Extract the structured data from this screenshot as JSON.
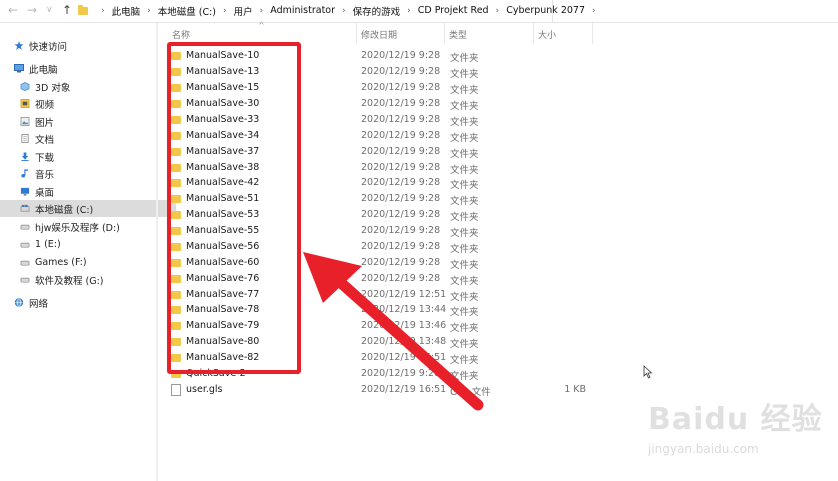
{
  "nav": {
    "back": "←",
    "forward": "→",
    "recent": "∨",
    "up": "↑"
  },
  "breadcrumb": [
    "此电脑",
    "本地磁盘 (C:)",
    "用户",
    "Administrator",
    "保存的游戏",
    "CD Projekt Red",
    "Cyberpunk 2077"
  ],
  "sidebar": {
    "items": [
      {
        "label": "快速访问",
        "icon": "star-icon"
      },
      {
        "label": "此电脑",
        "icon": "computer-icon"
      },
      {
        "label": "3D 对象",
        "icon": "cube-icon"
      },
      {
        "label": "视频",
        "icon": "video-icon"
      },
      {
        "label": "图片",
        "icon": "picture-icon"
      },
      {
        "label": "文档",
        "icon": "document-icon"
      },
      {
        "label": "下载",
        "icon": "download-icon"
      },
      {
        "label": "音乐",
        "icon": "music-icon"
      },
      {
        "label": "桌面",
        "icon": "desktop-icon"
      },
      {
        "label": "本地磁盘 (C:)",
        "icon": "drive-icon",
        "selected": true
      },
      {
        "label": "hjw娱乐及程序 (D:)",
        "icon": "drive-icon"
      },
      {
        "label": "1 (E:)",
        "icon": "drive-icon"
      },
      {
        "label": "Games (F:)",
        "icon": "drive-icon"
      },
      {
        "label": "软件及教程 (G:)",
        "icon": "drive-icon"
      },
      {
        "label": "网络",
        "icon": "network-icon"
      }
    ]
  },
  "columns": {
    "name": "名称",
    "date": "修改日期",
    "type": "类型",
    "size": "大小"
  },
  "files": [
    {
      "name": "ManualSave-10",
      "date": "2020/12/19 9:28",
      "type": "文件夹",
      "size": "",
      "kind": "folder"
    },
    {
      "name": "ManualSave-13",
      "date": "2020/12/19 9:28",
      "type": "文件夹",
      "size": "",
      "kind": "folder"
    },
    {
      "name": "ManualSave-15",
      "date": "2020/12/19 9:28",
      "type": "文件夹",
      "size": "",
      "kind": "folder"
    },
    {
      "name": "ManualSave-30",
      "date": "2020/12/19 9:28",
      "type": "文件夹",
      "size": "",
      "kind": "folder"
    },
    {
      "name": "ManualSave-33",
      "date": "2020/12/19 9:28",
      "type": "文件夹",
      "size": "",
      "kind": "folder"
    },
    {
      "name": "ManualSave-34",
      "date": "2020/12/19 9:28",
      "type": "文件夹",
      "size": "",
      "kind": "folder"
    },
    {
      "name": "ManualSave-37",
      "date": "2020/12/19 9:28",
      "type": "文件夹",
      "size": "",
      "kind": "folder"
    },
    {
      "name": "ManualSave-38",
      "date": "2020/12/19 9:28",
      "type": "文件夹",
      "size": "",
      "kind": "folder"
    },
    {
      "name": "ManualSave-42",
      "date": "2020/12/19 9:28",
      "type": "文件夹",
      "size": "",
      "kind": "folder"
    },
    {
      "name": "ManualSave-51",
      "date": "2020/12/19 9:28",
      "type": "文件夹",
      "size": "",
      "kind": "folder"
    },
    {
      "name": "ManualSave-53",
      "date": "2020/12/19 9:28",
      "type": "文件夹",
      "size": "",
      "kind": "folder"
    },
    {
      "name": "ManualSave-55",
      "date": "2020/12/19 9:28",
      "type": "文件夹",
      "size": "",
      "kind": "folder"
    },
    {
      "name": "ManualSave-56",
      "date": "2020/12/19 9:28",
      "type": "文件夹",
      "size": "",
      "kind": "folder"
    },
    {
      "name": "ManualSave-60",
      "date": "2020/12/19 9:28",
      "type": "文件夹",
      "size": "",
      "kind": "folder"
    },
    {
      "name": "ManualSave-76",
      "date": "2020/12/19 9:28",
      "type": "文件夹",
      "size": "",
      "kind": "folder"
    },
    {
      "name": "ManualSave-77",
      "date": "2020/12/19 12:51",
      "type": "文件夹",
      "size": "",
      "kind": "folder"
    },
    {
      "name": "ManualSave-78",
      "date": "2020/12/19 13:44",
      "type": "文件夹",
      "size": "",
      "kind": "folder"
    },
    {
      "name": "ManualSave-79",
      "date": "2020/12/19 13:46",
      "type": "文件夹",
      "size": "",
      "kind": "folder"
    },
    {
      "name": "ManualSave-80",
      "date": "2020/12/19 13:48",
      "type": "文件夹",
      "size": "",
      "kind": "folder"
    },
    {
      "name": "ManualSave-82",
      "date": "2020/12/19 16:51",
      "type": "文件夹",
      "size": "",
      "kind": "folder"
    },
    {
      "name": "QuickSave-2",
      "date": "2020/12/19 9:28",
      "type": "文件夹",
      "size": "",
      "kind": "folder"
    },
    {
      "name": "user.gls",
      "date": "2020/12/19 16:51",
      "type": "GLS 文件",
      "size": "1 KB",
      "kind": "file"
    }
  ],
  "colors": {
    "highlight": "#e8202a",
    "folder": "#f3c84a",
    "selected_bg": "#dcdcdc"
  },
  "watermark": {
    "logo": "Baidu 经验",
    "url": "jingyan.baidu.com"
  }
}
